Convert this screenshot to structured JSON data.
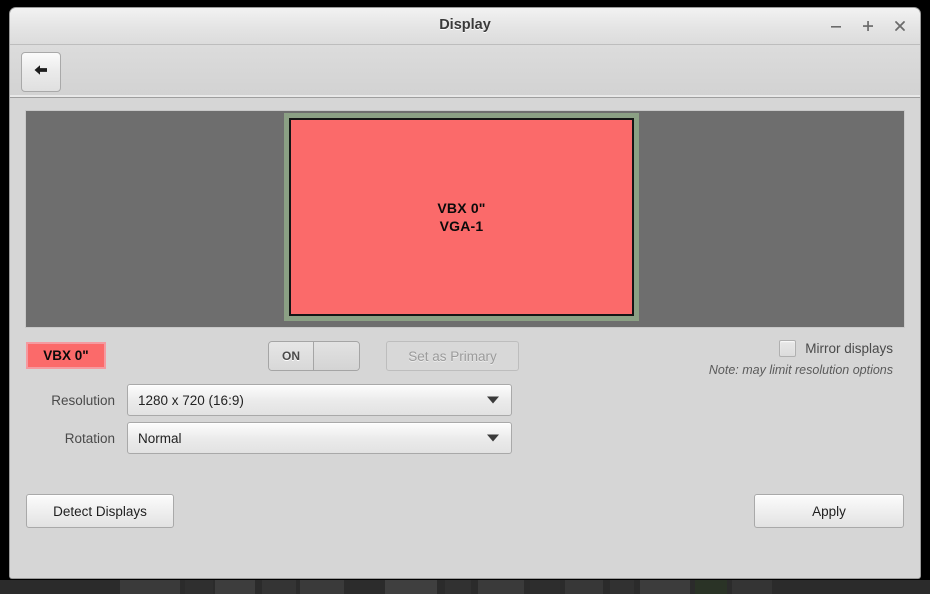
{
  "window": {
    "title": "Display",
    "controls": {
      "minimize": "minimize-icon",
      "maximize": "maximize-icon",
      "close": "close-icon"
    }
  },
  "toolbar": {
    "back_icon": "back-arrow-icon"
  },
  "preview": {
    "monitor": {
      "name": "VBX 0\"",
      "output": "VGA-1",
      "selected": true,
      "fill_color": "#fb6a6a",
      "selection_color": "#8ba084"
    },
    "canvas_color": "#6e6e6e"
  },
  "controls": {
    "display_chip_label": "VBX 0\"",
    "display_chip_color": "#fb6a6a",
    "toggle_state_label": "ON",
    "set_primary_label": "Set as Primary",
    "set_primary_enabled": false,
    "mirror_label": "Mirror displays",
    "mirror_checked": false,
    "mirror_note": "Note: may limit resolution options"
  },
  "form": {
    "resolution_label": "Resolution",
    "resolution_value": "1280 x 720 (16:9)",
    "rotation_label": "Rotation",
    "rotation_value": "Normal"
  },
  "footer": {
    "detect_label": "Detect Displays",
    "apply_label": "Apply"
  }
}
